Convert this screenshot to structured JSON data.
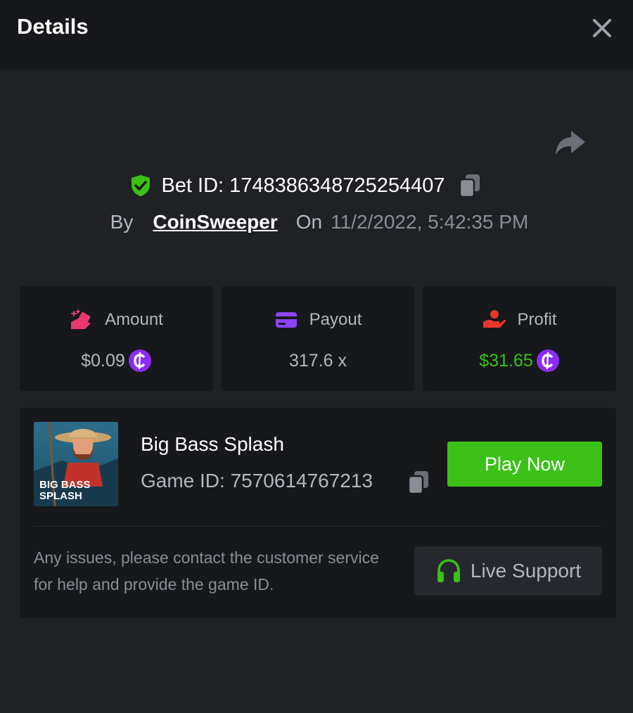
{
  "header": {
    "title": "Details",
    "close_icon": "close-icon"
  },
  "share_icon": "share-arrow-icon",
  "bet": {
    "id_label": "Bet ID:",
    "id_value": "1748386348725254407",
    "verified_icon": "shield-check-icon",
    "copy_icon": "copy-icon",
    "by_label": "By",
    "username": "CoinSweeper",
    "on_label": "On",
    "datetime": "11/2/2022, 5:42:35 PM"
  },
  "stats": [
    {
      "label": "Amount",
      "value": "$0.09",
      "icon": "money-hand-icon",
      "coin": true,
      "accent": "#e8396f"
    },
    {
      "label": "Payout",
      "value": "317.6 x",
      "icon": "card-icon",
      "coin": false,
      "accent": "#8b44f7"
    },
    {
      "label": "Profit",
      "value": "$31.65",
      "icon": "profit-hand-icon",
      "coin": true,
      "accent": "#e8382c"
    }
  ],
  "game": {
    "name": "Big Bass Splash",
    "id_label": "Game ID:",
    "id_value": "7570614767213",
    "thumbnail_text_line1": "BIG BASS",
    "thumbnail_text_line2": "SPLASH",
    "play_label": "Play Now",
    "help_text": "Any issues, please contact the customer service for help and provide the game ID.",
    "support_label": "Live Support",
    "support_icon": "headset-icon"
  },
  "colors": {
    "background": "#202125",
    "card": "#17181b",
    "green": "#3bc117",
    "coin_purple": "#8b2cf5",
    "muted_text": "#b4b7bf"
  }
}
